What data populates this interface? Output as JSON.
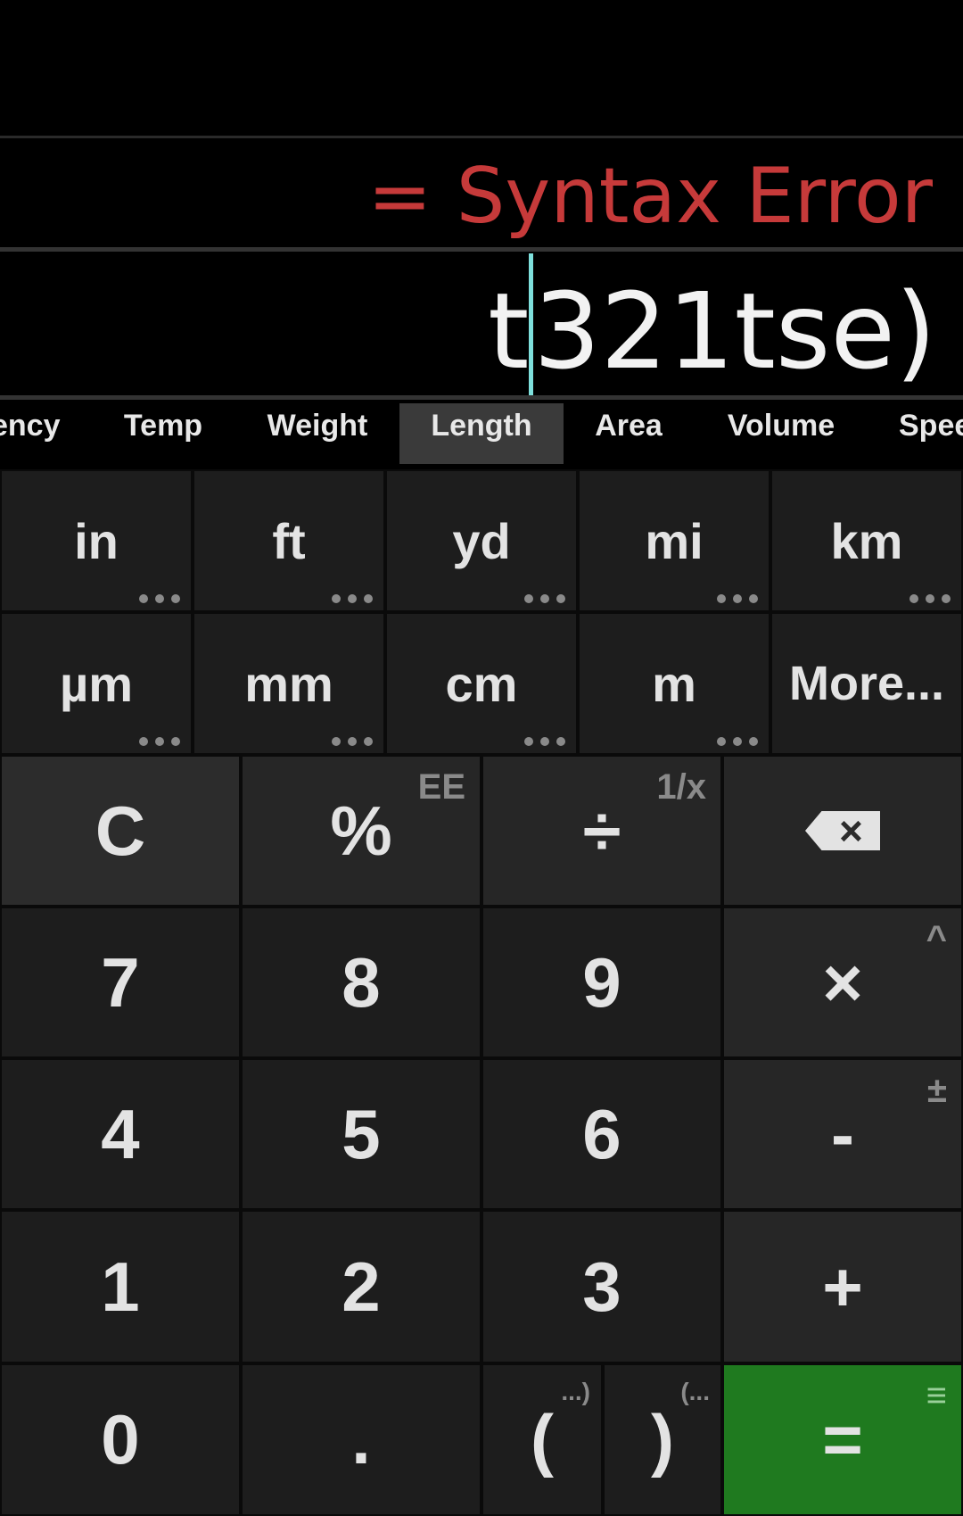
{
  "display": {
    "result": "= Syntax Error",
    "expression_before_cursor": "t",
    "expression_after_cursor": "321tse)"
  },
  "tabs": [
    "ency",
    "Temp",
    "Weight",
    "Length",
    "Area",
    "Volume",
    "Spee"
  ],
  "active_tab": "Length",
  "units": {
    "row1": [
      "in",
      "ft",
      "yd",
      "mi",
      "km"
    ],
    "row2": [
      "µm",
      "mm",
      "cm",
      "m",
      "More..."
    ]
  },
  "keypad": {
    "clear": "C",
    "percent": "%",
    "percent_secondary": "EE",
    "divide": "÷",
    "divide_secondary": "1/x",
    "backspace_icon": "backspace-icon",
    "seven": "7",
    "eight": "8",
    "nine": "9",
    "multiply": "×",
    "multiply_secondary": "^",
    "four": "4",
    "five": "5",
    "six": "6",
    "minus": "-",
    "minus_secondary": "±",
    "one": "1",
    "two": "2",
    "three": "3",
    "plus": "+",
    "zero": "0",
    "dot": ".",
    "open_paren": "(",
    "open_paren_secondary": "...)",
    "close_paren": ")",
    "close_paren_secondary": "(...",
    "equals": "=",
    "equals_secondary": "≡"
  },
  "colors": {
    "error": "#c63a3a",
    "cursor": "#7ee0dc",
    "equals_bg": "#1f7a1f"
  }
}
